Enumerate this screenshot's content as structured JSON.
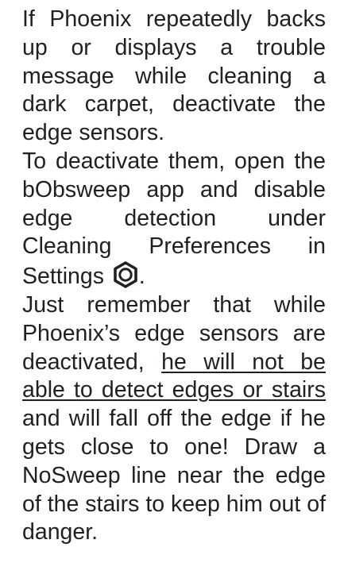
{
  "paragraphs": {
    "p1": "If Phoenix repeatedly backs up or displays a trouble message while cleaning a dark carpet, deactivate the edge sensors.",
    "p2_before_icon": "To deactivate them, open the bObsweep app and disable edge detection under Cleaning Preferences in Settings",
    "p2_after_icon": ".",
    "p3_before_underline": "Just remember that while Phoenix’s edge sensors are deactivated, ",
    "p3_underlined": "he will not be able to detect edges or stairs",
    "p3_after_underline": " and will fall off the edge if he gets close to one! Draw a NoSweep line near the edge of the stairs to keep him out of danger."
  },
  "icons": {
    "settings": "gear-icon"
  },
  "colors": {
    "text": "#231f20",
    "background": "#ffffff"
  }
}
